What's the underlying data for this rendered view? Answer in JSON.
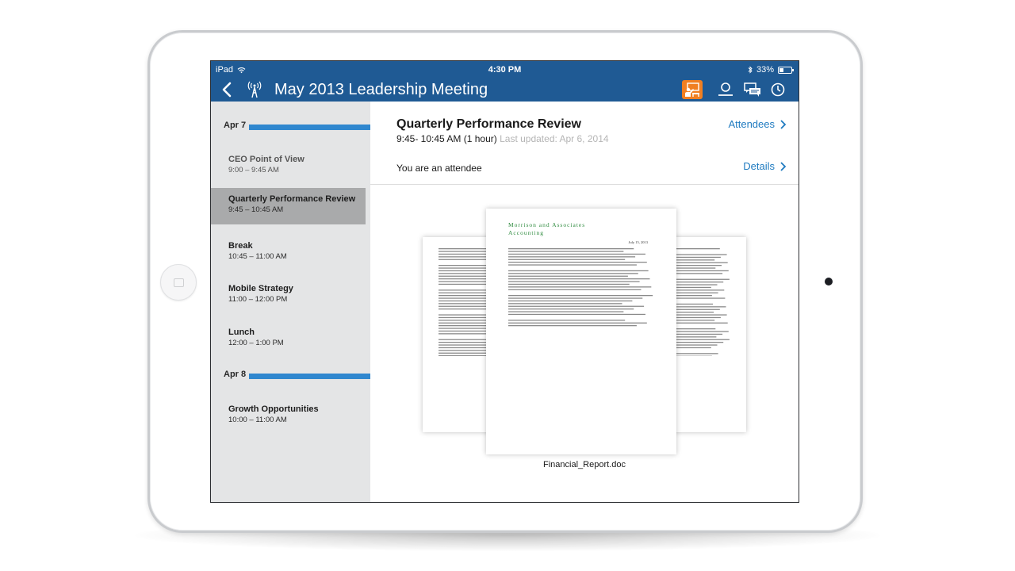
{
  "status_bar": {
    "carrier": "iPad",
    "time": "4:30 PM",
    "battery": "33%"
  },
  "nav_bar": {
    "title": "May 2013 Leadership Meeting",
    "accent_color": "#f07f22",
    "bar_color": "#1f5a94",
    "icons": [
      "back-chevron-icon",
      "radio-tower-icon",
      "presenter-icon",
      "profile-icon",
      "chat-icon",
      "clock-icon"
    ]
  },
  "sidebar": {
    "groups": [
      {
        "date": "Apr 7",
        "items": [
          {
            "title": "CEO Point of View",
            "time": "9:00 – 9:45 AM",
            "state": "past"
          },
          {
            "title": "Quarterly Performance Review",
            "time": "9:45 – 10:45 AM",
            "state": "selected"
          },
          {
            "title": "Break",
            "time": "10:45 – 11:00 AM",
            "state": "upcoming"
          },
          {
            "title": "Mobile Strategy",
            "time": "11:00 – 12:00 PM",
            "state": "upcoming"
          },
          {
            "title": "Lunch",
            "time": "12:00 – 1:00 PM",
            "state": "upcoming"
          }
        ]
      },
      {
        "date": "Apr 8",
        "items": [
          {
            "title": "Growth Opportunities",
            "time": "10:00 – 11:00 AM",
            "state": "upcoming"
          }
        ]
      }
    ]
  },
  "main": {
    "session_title": "Quarterly Performance Review",
    "session_time": "9:45- 10:45 AM (1 hour)",
    "last_updated": "Last updated: Apr 6, 2014",
    "attendees_link": "Attendees",
    "attendee_status": "You are an attendee",
    "details_link": "Details",
    "document": {
      "letterhead_line1": "Morrison and Associates",
      "letterhead_line2": "Accounting",
      "date": "July 15, 2013",
      "filename": "Financial_Report.doc"
    }
  }
}
